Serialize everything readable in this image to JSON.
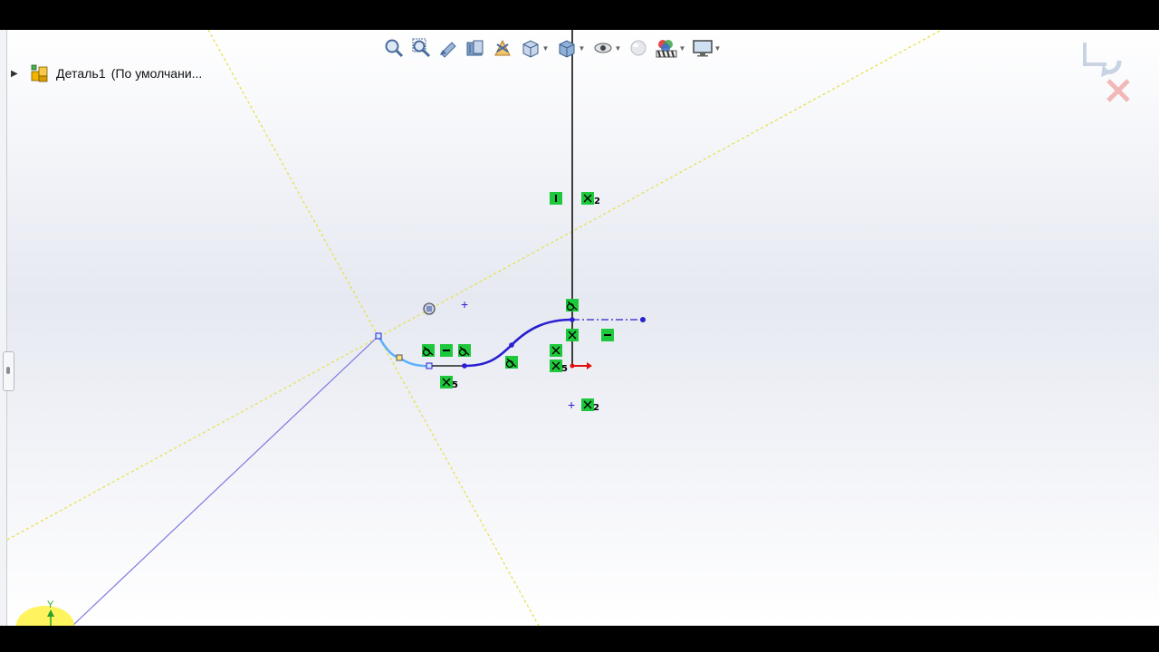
{
  "feature_tree": {
    "part_name": "Деталь1",
    "configuration": "(По умолчани..."
  },
  "heads_up_toolbar": {
    "buttons": [
      {
        "name": "zoom-to-fit",
        "icon": "zoom-fit-icon",
        "has_menu": false
      },
      {
        "name": "zoom-to-area",
        "icon": "zoom-area-icon",
        "has_menu": false
      },
      {
        "name": "previous-view",
        "icon": "previous-view-icon",
        "has_menu": false
      },
      {
        "name": "section-view",
        "icon": "section-view-icon",
        "has_menu": false
      },
      {
        "name": "dynamic-annotation-views",
        "icon": "annotation-view-icon",
        "has_menu": false
      },
      {
        "name": "view-orientation",
        "icon": "view-orientation-icon",
        "has_menu": true
      },
      {
        "name": "display-style",
        "icon": "display-style-icon",
        "has_menu": true
      },
      {
        "name": "hide-show-items",
        "icon": "hide-show-icon",
        "has_menu": true
      },
      {
        "name": "edit-appearance",
        "icon": "appearance-icon",
        "has_menu": false
      },
      {
        "name": "apply-scene",
        "icon": "scene-icon",
        "has_menu": true
      },
      {
        "name": "view-settings",
        "icon": "monitor-icon",
        "has_menu": true
      }
    ]
  },
  "confirmation_corner": {
    "exit_sketch": "exit-sketch-icon",
    "cancel": "cancel-icon"
  },
  "sketch": {
    "relation_labels": [
      "2",
      "5",
      "5",
      "2"
    ],
    "axis_label": "Y"
  },
  "colors": {
    "sketch_line": "#2a1fd0",
    "selected_line": "#5ab0ff",
    "relation_bg": "#1ec83c",
    "construction_line": "#e8e04a",
    "origin_red": "#e01010",
    "origin_y": "#2aa02a",
    "highlight": "#fff34d"
  }
}
